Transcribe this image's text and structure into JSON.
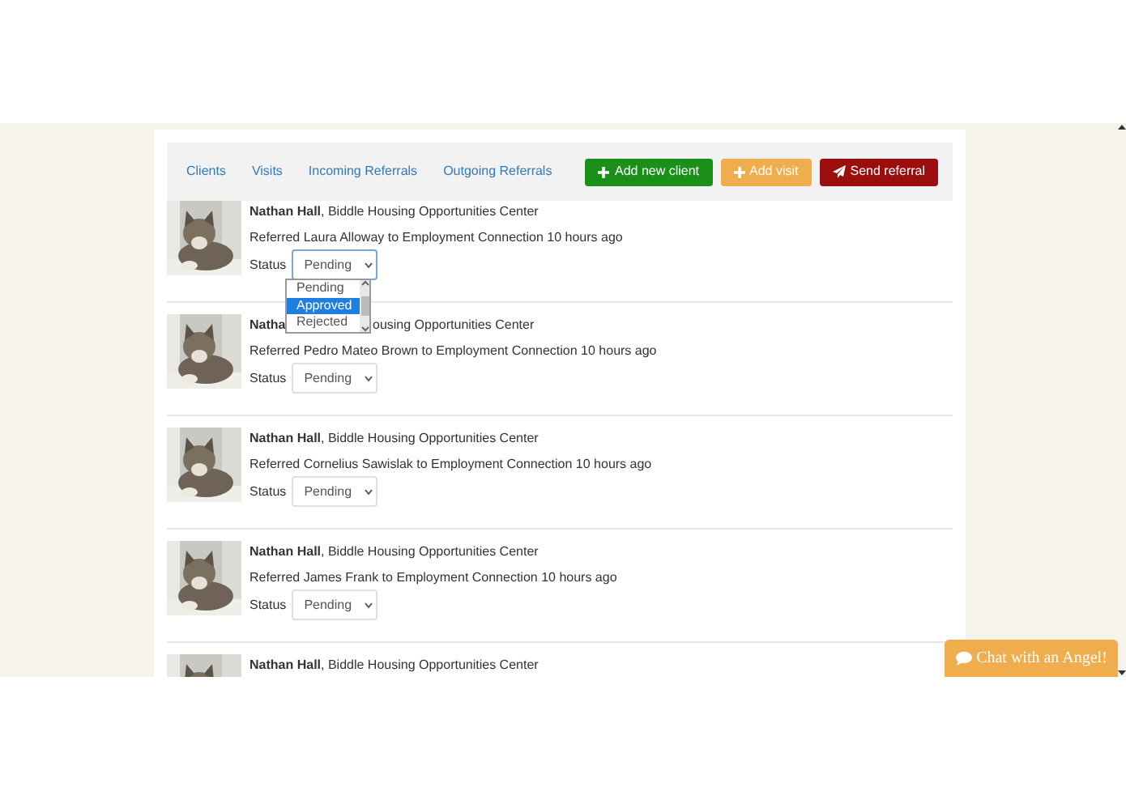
{
  "nav": {
    "links": [
      {
        "label": "Clients"
      },
      {
        "label": "Visits"
      },
      {
        "label": "Incoming Referrals"
      },
      {
        "label": "Outgoing Referrals"
      }
    ],
    "buttons": [
      {
        "label": "Add new client",
        "kind": "success"
      },
      {
        "label": "Add visit",
        "kind": "warning"
      },
      {
        "label": "Send referral",
        "kind": "danger"
      }
    ]
  },
  "referrals": [
    {
      "agent": "Nathan Hall",
      "org": ", Biddle Housing Opportunities Center",
      "message": "Referred Laura Alloway to Employment Connection 10 hours ago",
      "status_label": "Status",
      "status": "Pending",
      "options": [
        {
          "label": "Pending",
          "selected": false
        },
        {
          "label": "Approved",
          "selected": true
        },
        {
          "label": "Rejected",
          "selected": false
        }
      ]
    },
    {
      "agent": "Natha",
      "org": "ousing Opportunities Center",
      "covered": true,
      "message": "Referred Pedro Mateo Brown to Employment Connection 10 hours ago",
      "status_label": "Status",
      "status": "Pending"
    },
    {
      "agent": "Nathan Hall",
      "org": ", Biddle Housing Opportunities Center",
      "message": "Referred Cornelius Sawislak to Employment Connection 10 hours ago",
      "status_label": "Status",
      "status": "Pending"
    },
    {
      "agent": "Nathan Hall",
      "org": ", Biddle Housing Opportunities Center",
      "message": "Referred James Frank to Employment Connection 10 hours ago",
      "status_label": "Status",
      "status": "Pending"
    },
    {
      "agent": "Nathan Hall",
      "org": ", Biddle Housing Opportunities Center"
    }
  ],
  "chat_button": {
    "label": "Chat with an Angel!"
  }
}
